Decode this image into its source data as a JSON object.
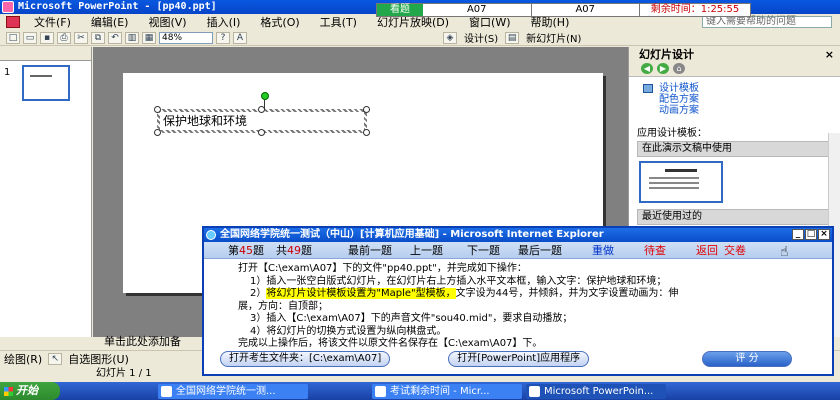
{
  "window": {
    "title": "Microsoft PowerPoint - [pp40.ppt]"
  },
  "timer": {
    "watch_label": "看题",
    "question_id": "A07",
    "question_id_2": "A07",
    "remaining_label": "剩余时间：1:25:55"
  },
  "menu": {
    "items": [
      "文件(F)",
      "编辑(E)",
      "视图(V)",
      "插入(I)",
      "格式(O)",
      "工具(T)",
      "幻灯片放映(D)",
      "窗口(W)",
      "帮助(H)"
    ],
    "help_placeholder": "键入需要帮助的问题"
  },
  "toolbar": {
    "zoom": "48%",
    "design_label": "设计(S)",
    "new_slide_label": "新幻灯片(N)"
  },
  "slides_panel": {
    "slide_number": "1"
  },
  "slide": {
    "textbox_text": "保护地球和环境"
  },
  "task_pane": {
    "title": "幻灯片设计",
    "links": [
      "设计模板",
      "配色方案",
      "动画方案"
    ],
    "apply_label": "应用设计模板：",
    "section_current": "在此演示文稿中使用",
    "section_recent": "最近使用过的"
  },
  "notes": {
    "placeholder": "单击此处添加备"
  },
  "drawbar": {
    "draw_label": "绘图(R)",
    "autoshape_label": "自选图形(U)"
  },
  "status": {
    "slide_info": "幻灯片 1 / 1"
  },
  "taskbar": {
    "start": "开始",
    "tasks": [
      "全国网络学院统一测...",
      "考试剩余时间 - Micr...",
      "Microsoft PowerPoin..."
    ]
  },
  "exam": {
    "title": "全国网络学院统一测试（中山）[计算机应用基础] - Microsoft Internet Explorer",
    "nav": {
      "current_prefix": "第",
      "current_num": "45",
      "current_suffix": "题",
      "total_prefix": "共",
      "total_num": "49",
      "total_suffix": "题",
      "first": "最前一题",
      "prev": "上一题",
      "next": "下一题",
      "last": "最后一题",
      "redo": "重做",
      "later": "待查",
      "back": "返回",
      "submit": "交卷"
    },
    "intro_a": "打开【C:\\exam\\A07】下的文件\"pp40.ppt\"，并完成如下操作：",
    "step1": "1）插入一张空白版式幻灯片，在幻灯片右上方插入水平文本框，输入文字：保护地球和环境；",
    "step2_num": "2）",
    "step2_hl": "将幻灯片设计模板设置为\"Maple\"型模板，",
    "step2_rest": "文字设为44号，并倾斜，并为文字设置动画为：伸",
    "step2_cont": "展，方向：自顶部；",
    "step3": "3）插入【C:\\exam\\A07】下的声音文件\"sou40.mid\"，要求自动播放；",
    "step4": "4）将幻灯片的切换方式设置为纵向棋盘式。",
    "outro": "完成以上操作后，将该文件以原文件名保存在【C:\\exam\\A07】下。",
    "btn_open_folder": "打开考生文件夹：[C:\\exam\\A07]",
    "btn_open_app": "打开[PowerPoint]应用程序",
    "btn_score": "评 分"
  }
}
